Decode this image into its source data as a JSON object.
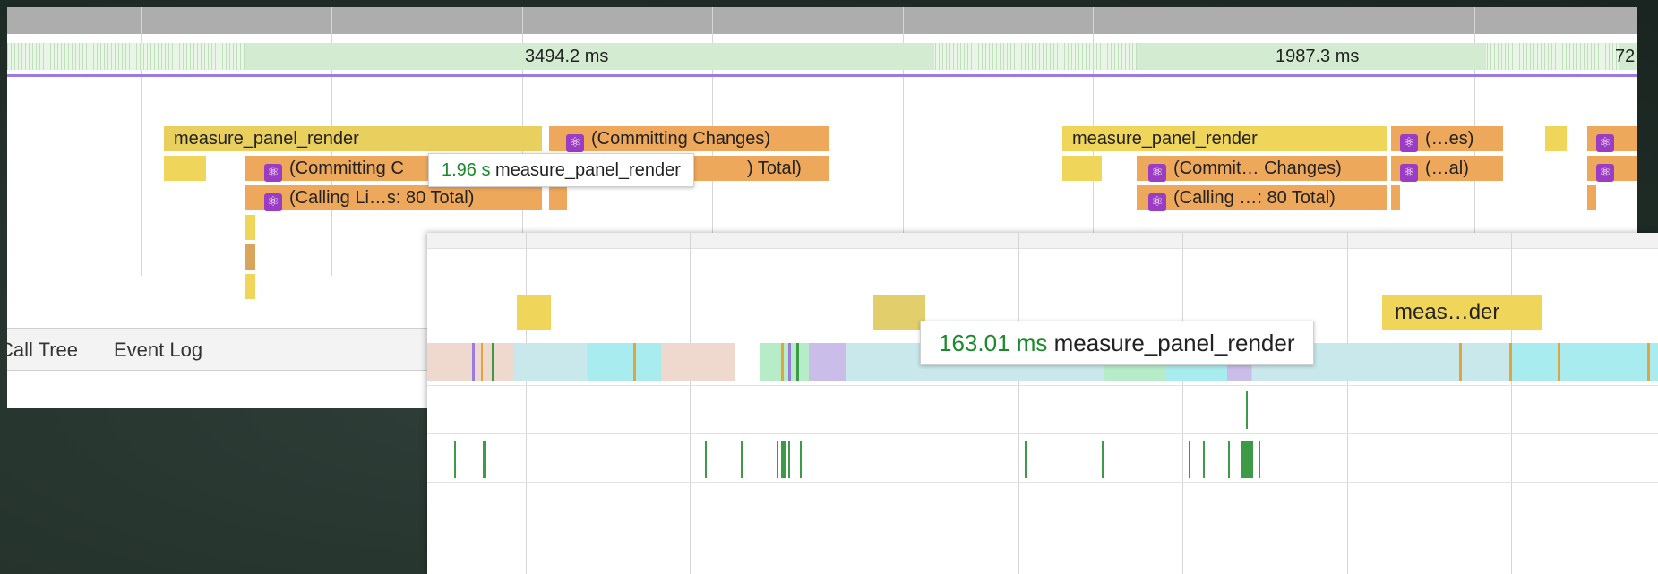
{
  "overview": {
    "durations": [
      "3494.2 ms",
      "1987.3 ms",
      "72"
    ]
  },
  "flame": {
    "marker_label": "measure_panel_render",
    "commit_label": "(Committing Changes)",
    "commit_trunc": "(Committing C",
    "total_suffix": ") Total)",
    "calling_label": "(Calling Li…s: 80 Total)",
    "marker_label_2": "measure_panel_render",
    "es_label": "(…es)",
    "commit_label_2": "(Commit… Changes)",
    "al_label": "(…al)",
    "calling_label_2": "(Calling …: 80 Total)"
  },
  "tooltip_back": {
    "duration": "1.96 s",
    "name": "measure_panel_render"
  },
  "tabs": {
    "call_tree": "Call Tree",
    "event_log": "Event Log"
  },
  "front": {
    "marker_truncated": "meas…der",
    "tooltip": {
      "duration": "163.01 ms",
      "name": "measure_panel_render"
    }
  },
  "icons": {
    "react": "react-atom-icon"
  },
  "colors": {
    "timing_yellow": "#f0d55b",
    "react_orange": "#eea85c",
    "react_icon": "#9b3cc4",
    "duration_green": "#1b8a2a",
    "frame_line": "#9a7be0",
    "frame_green": "#d5ecd2"
  }
}
